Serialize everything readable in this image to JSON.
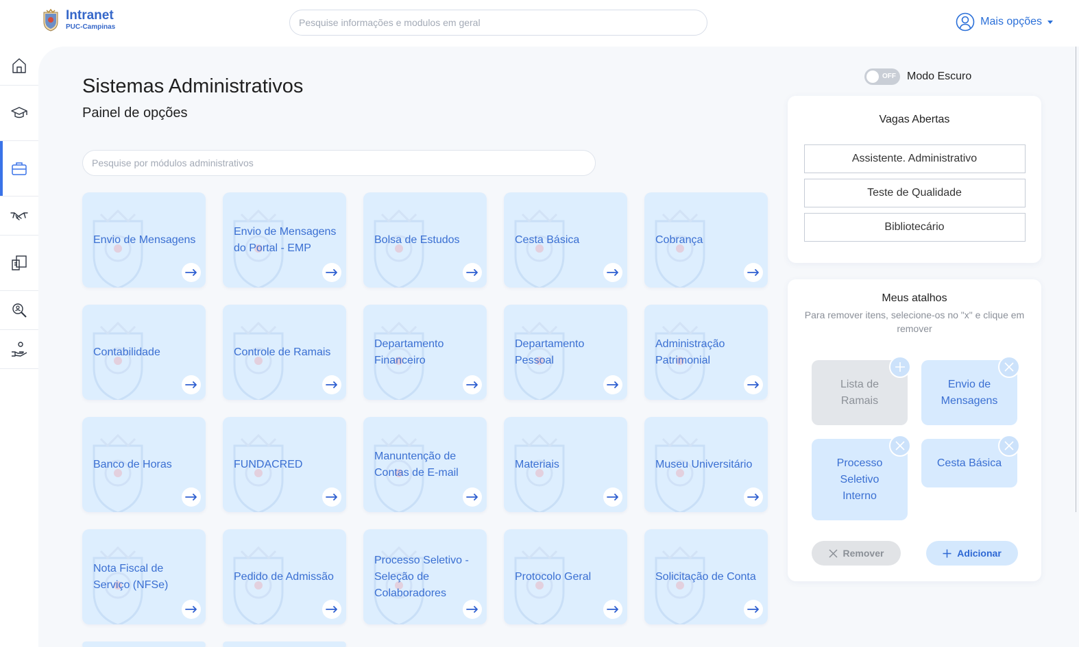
{
  "colors": {
    "accent": "#3a73e8",
    "card_bg": "#ddeefe",
    "card_text": "#3a6fd2",
    "page_bg": "#f6f8fb"
  },
  "header": {
    "logo_title": "Intranet",
    "logo_subtitle": "PUC-Campinas",
    "search_placeholder": "Pesquise informações e modulos em geral",
    "more_options_label": "Mais opções"
  },
  "sidebar": {
    "items": [
      {
        "icon": "home-icon",
        "active": false
      },
      {
        "icon": "graduation-cap-icon",
        "active": false
      },
      {
        "icon": "briefcase-icon",
        "active": true
      },
      {
        "icon": "handshake-icon",
        "active": false
      },
      {
        "icon": "documents-icon",
        "active": false
      },
      {
        "icon": "search-person-icon",
        "active": false
      },
      {
        "icon": "hand-coins-icon",
        "active": false
      }
    ]
  },
  "main": {
    "title": "Sistemas Administrativos",
    "subtitle": "Painel de opções",
    "module_search_placeholder": "Pesquise por módulos administrativos",
    "modules": [
      "Envio de Mensagens",
      "Envio de Mensagens do Portal - EMP",
      "Bolsa de Estudos",
      "Cesta Básica",
      "Cobrança",
      "Contabilidade",
      "Controle de Ramais",
      "Departamento Financeiro",
      "Departamento Pessoal",
      "Administração Patrimonial",
      "Banco de Horas",
      "FUNDACRED",
      "Manuntenção de Contas de E-mail",
      "Materiais",
      "Museu Universitário",
      "Nota Fiscal de Serviço (NFSe)",
      "Pedido de Admissão",
      "Processo Seletivo - Seleção de Colaboradores",
      "Protocolo Geral",
      "Solicitação de Conta"
    ]
  },
  "dark_mode": {
    "toggle_state": "OFF",
    "label": "Modo Escuro",
    "enabled": false
  },
  "vagas": {
    "title": "Vagas Abertas",
    "items": [
      "Assistente. Administrativo",
      "Teste de Qualidade",
      "Bibliotecário"
    ]
  },
  "atalhos": {
    "title": "Meus atalhos",
    "hint": "Para remover itens, selecione-os no \"x\" e clique em remover",
    "items": [
      {
        "label": "Lista de Ramais",
        "state": "add"
      },
      {
        "label": "Envio de Mensagens",
        "state": "remove"
      },
      {
        "label": "Processo Seletivo Interno",
        "state": "remove"
      },
      {
        "label": "Cesta Básica",
        "state": "remove"
      }
    ],
    "remove_label": "Remover",
    "add_label": "Adicionar"
  }
}
